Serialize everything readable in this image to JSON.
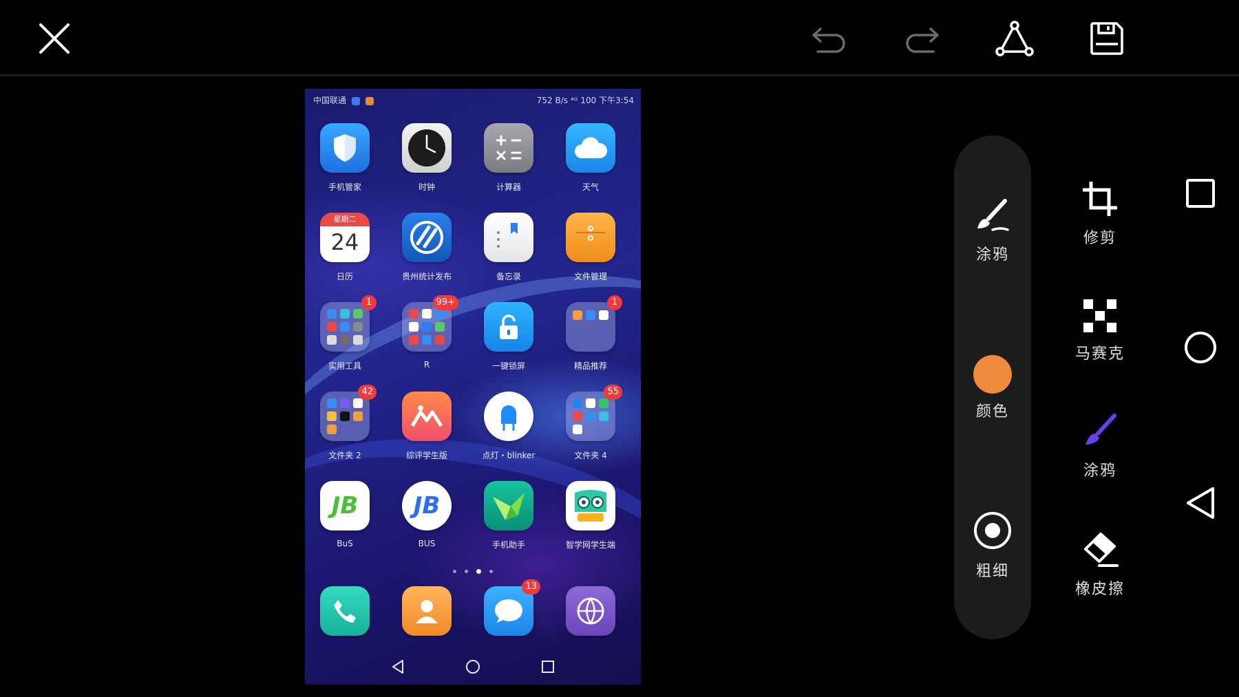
{
  "toolbar": {
    "close_icon": "close-icon",
    "undo_icon": "undo-icon",
    "redo_icon": "redo-icon",
    "share_icon": "share-icon",
    "save_icon": "save-icon"
  },
  "phone": {
    "status_bar": {
      "carrier": "中国联通",
      "right": "752 B/s  ⁴ᴳ  100  下午3:54"
    },
    "apps": [
      {
        "label": "手机管家",
        "badge": ""
      },
      {
        "label": "时钟",
        "badge": ""
      },
      {
        "label": "计算器",
        "badge": ""
      },
      {
        "label": "天气",
        "badge": ""
      },
      {
        "label": "日历",
        "badge": "",
        "calendar_weekday": "星期二",
        "calendar_day": "24"
      },
      {
        "label": "贵州统计发布",
        "badge": ""
      },
      {
        "label": "备忘录",
        "badge": ""
      },
      {
        "label": "文件管理",
        "badge": ""
      },
      {
        "label": "实用工具",
        "badge": "1"
      },
      {
        "label": "R",
        "badge": "99+"
      },
      {
        "label": "一键锁屏",
        "badge": ""
      },
      {
        "label": "精品推荐",
        "badge": "1"
      },
      {
        "label": "文件夹 2",
        "badge": "42"
      },
      {
        "label": "综评学生版",
        "badge": ""
      },
      {
        "label": "点灯・blinker",
        "badge": ""
      },
      {
        "label": "文件夹 4",
        "badge": "55"
      },
      {
        "label": "BuS",
        "badge": ""
      },
      {
        "label": "BUS",
        "badge": ""
      },
      {
        "label": "手机助手",
        "badge": ""
      },
      {
        "label": "智学网学生端",
        "badge": ""
      }
    ],
    "dock": [
      {
        "name": "phone",
        "badge": ""
      },
      {
        "name": "contacts",
        "badge": ""
      },
      {
        "name": "messages",
        "badge": "13"
      },
      {
        "name": "browser",
        "badge": ""
      }
    ]
  },
  "editor_panel": {
    "graffiti_label": "涂鸦",
    "color_label": "颜色",
    "thickness_label": "粗细",
    "selected_color": "#ef8a3c"
  },
  "tools": {
    "crop_label": "修剪",
    "mosaic_label": "马赛克",
    "graffiti_label": "涂鸦",
    "eraser_label": "橡皮擦",
    "graffiti_color": "#6a3df0"
  }
}
